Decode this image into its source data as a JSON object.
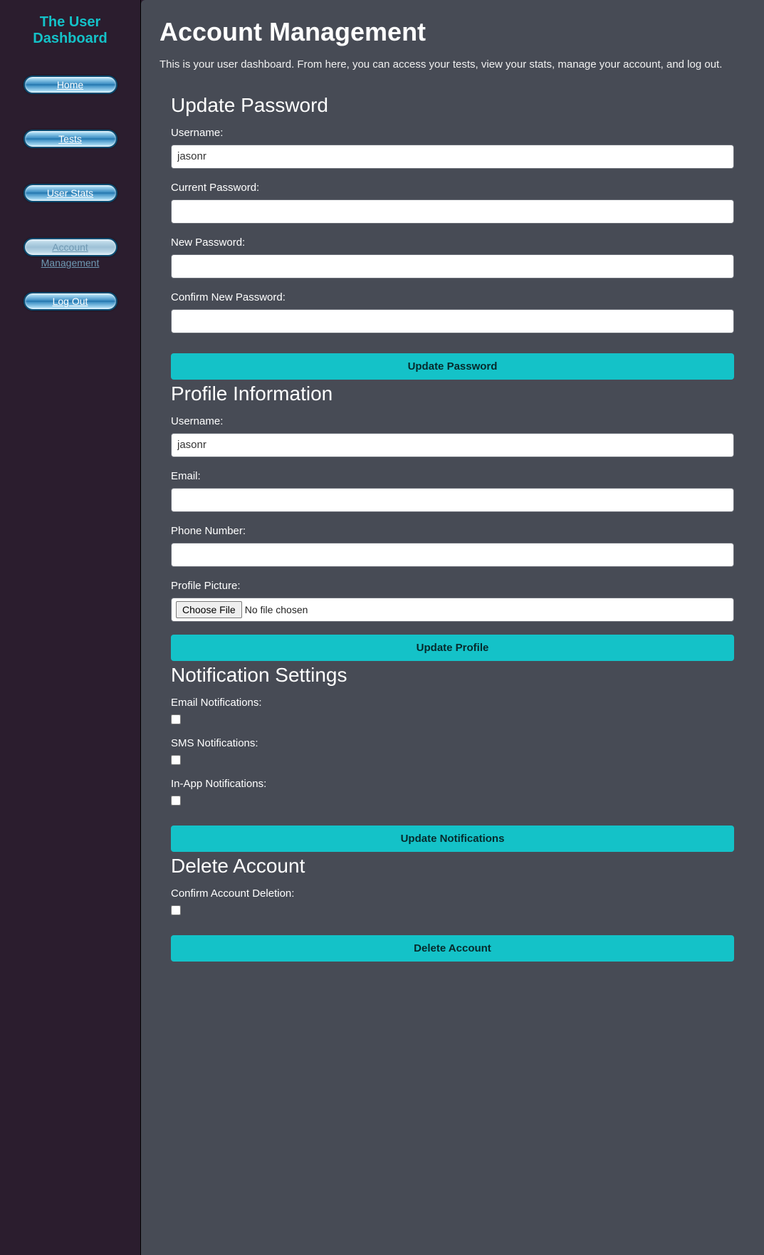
{
  "sidebar": {
    "title": "The User Dashboard",
    "items": [
      {
        "label": "Home"
      },
      {
        "label": "Tests"
      },
      {
        "label": "User Stats"
      },
      {
        "label": "Account Management"
      },
      {
        "label": "Log Out"
      }
    ]
  },
  "page": {
    "title": "Account Management",
    "description": "This is your user dashboard. From here, you can access your tests, view your stats, manage your account, and log out."
  },
  "password_section": {
    "heading": "Update Password",
    "username_label": "Username:",
    "username_value": "jasonr",
    "current_pw_label": "Current Password:",
    "new_pw_label": "New Password:",
    "confirm_pw_label": "Confirm New Password:",
    "submit_label": "Update Password"
  },
  "profile_section": {
    "heading": "Profile Information",
    "username_label": "Username:",
    "username_value": "jasonr",
    "email_label": "Email:",
    "phone_label": "Phone Number:",
    "picture_label": "Profile Picture:",
    "choose_file_label": "Choose File",
    "no_file_text": "No file chosen",
    "submit_label": "Update Profile"
  },
  "notifications_section": {
    "heading": "Notification Settings",
    "email_label": "Email Notifications:",
    "sms_label": "SMS Notifications:",
    "inapp_label": "In-App Notifications:",
    "submit_label": "Update Notifications"
  },
  "delete_section": {
    "heading": "Delete Account",
    "confirm_label": "Confirm Account Deletion:",
    "submit_label": "Delete Account"
  }
}
